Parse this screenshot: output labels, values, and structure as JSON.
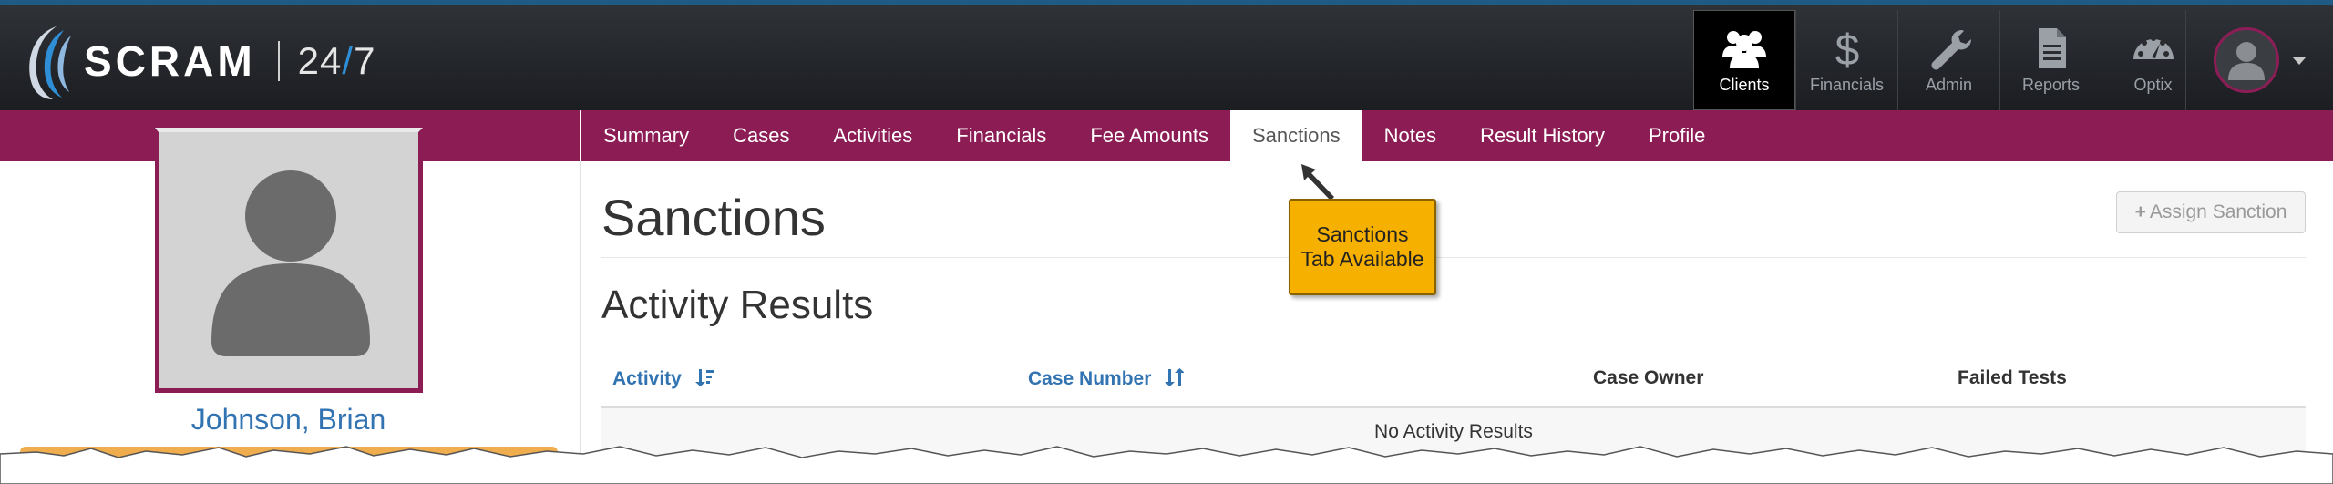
{
  "brand": {
    "name": "SCRAM",
    "suffix_num1": "24",
    "suffix_slash": "/",
    "suffix_num2": "7"
  },
  "nav": [
    {
      "label": "Clients",
      "icon": "users-icon",
      "active": true
    },
    {
      "label": "Financials",
      "icon": "dollar-icon",
      "active": false
    },
    {
      "label": "Admin",
      "icon": "wrench-icon",
      "active": false
    },
    {
      "label": "Reports",
      "icon": "document-icon",
      "active": false
    },
    {
      "label": "Optix",
      "icon": "dashboard-icon",
      "active": false
    }
  ],
  "tabs": [
    {
      "label": "Summary"
    },
    {
      "label": "Cases"
    },
    {
      "label": "Activities"
    },
    {
      "label": "Financials"
    },
    {
      "label": "Fee Amounts"
    },
    {
      "label": "Sanctions",
      "active": true
    },
    {
      "label": "Notes"
    },
    {
      "label": "Result History"
    },
    {
      "label": "Profile"
    }
  ],
  "client": {
    "name": "Johnson, Brian"
  },
  "page": {
    "title": "Sanctions",
    "assign_button": "Assign Sanction"
  },
  "results": {
    "title": "Activity Results",
    "columns": {
      "activity": "Activity",
      "case_number": "Case Number",
      "case_owner": "Case Owner",
      "failed_tests": "Failed Tests"
    },
    "empty_message": "No Activity Results"
  },
  "callout": {
    "line1": "Sanctions",
    "line2": "Tab Available"
  },
  "colors": {
    "accent": "#8b1c54",
    "topbar": "#24272b",
    "link": "#3273b2",
    "callout": "#f5b000"
  }
}
